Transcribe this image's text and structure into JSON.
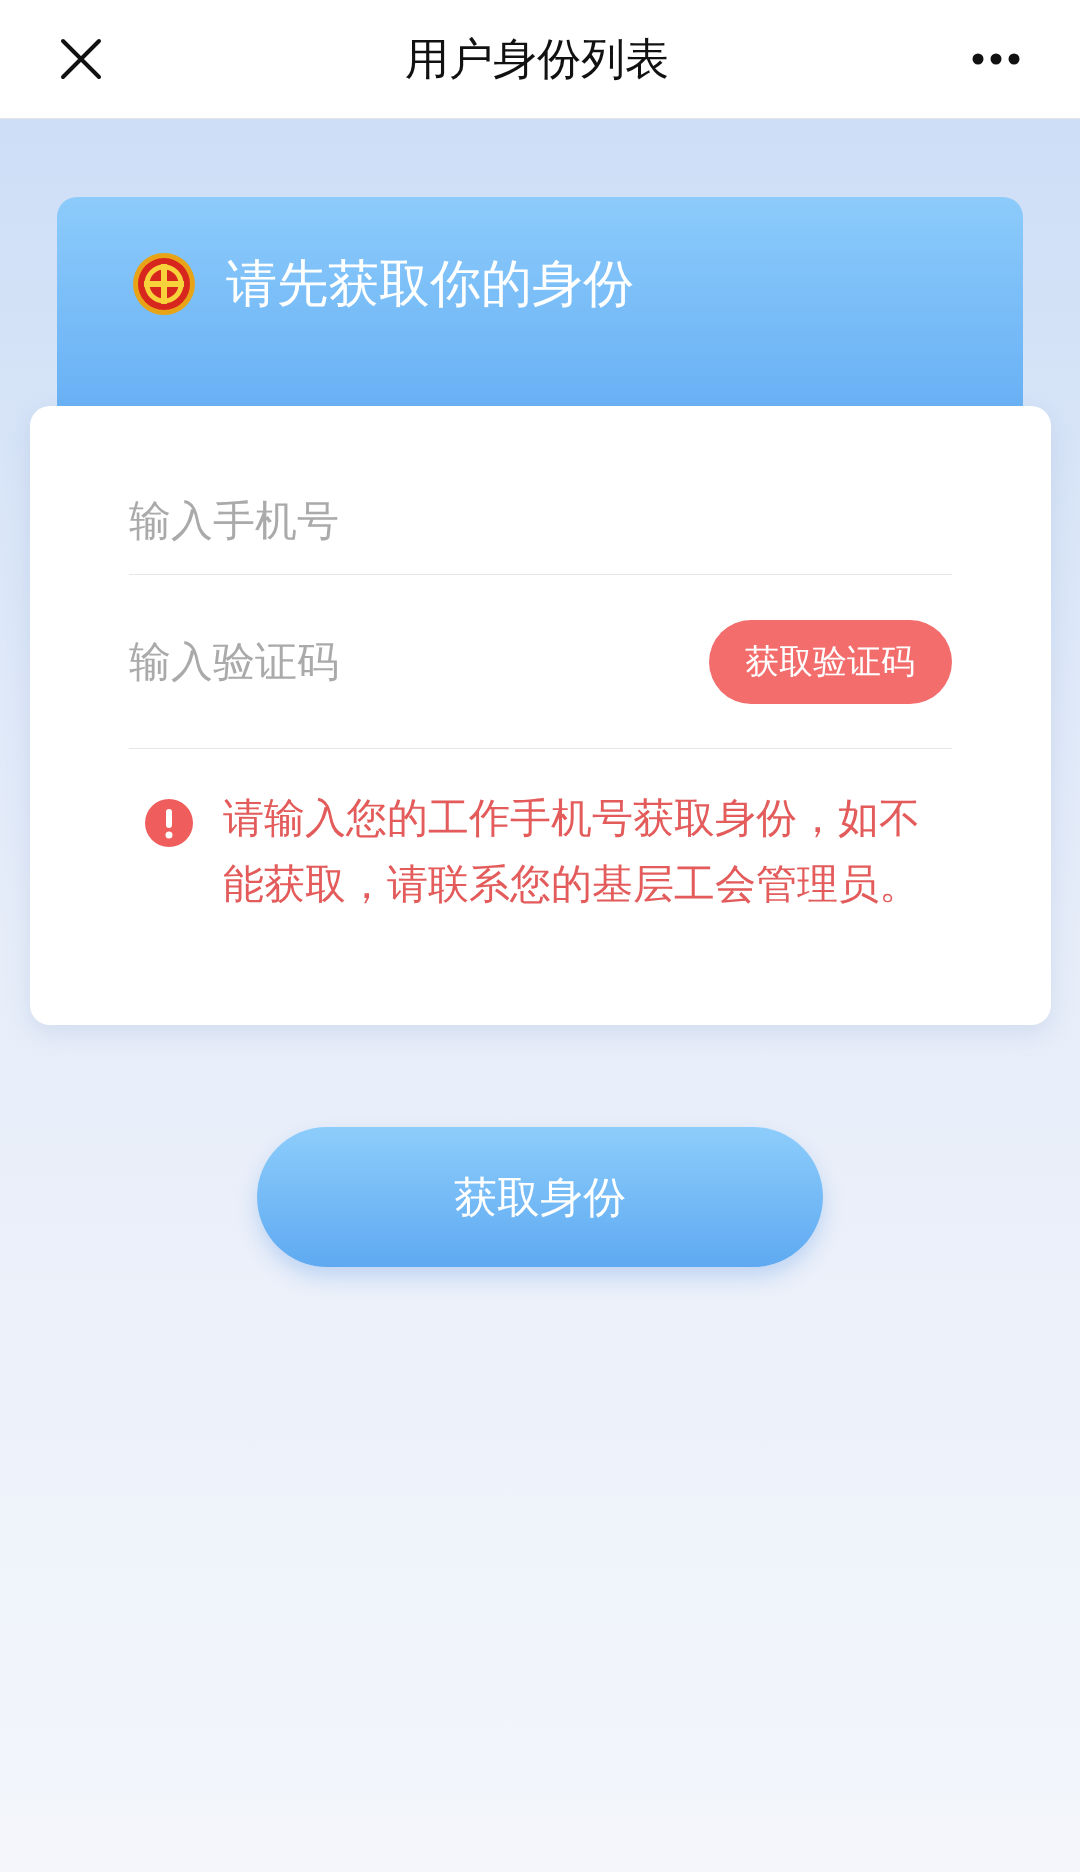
{
  "nav": {
    "title": "用户身份列表"
  },
  "banner": {
    "title": "请先获取你的身份"
  },
  "form": {
    "phone": {
      "placeholder": "输入手机号"
    },
    "code": {
      "placeholder": "输入验证码"
    },
    "code_button": "获取验证码",
    "notice": "请输入您的工作手机号获取身份，如不能获取，请联系您的基层工会管理员。"
  },
  "submit": "获取身份"
}
